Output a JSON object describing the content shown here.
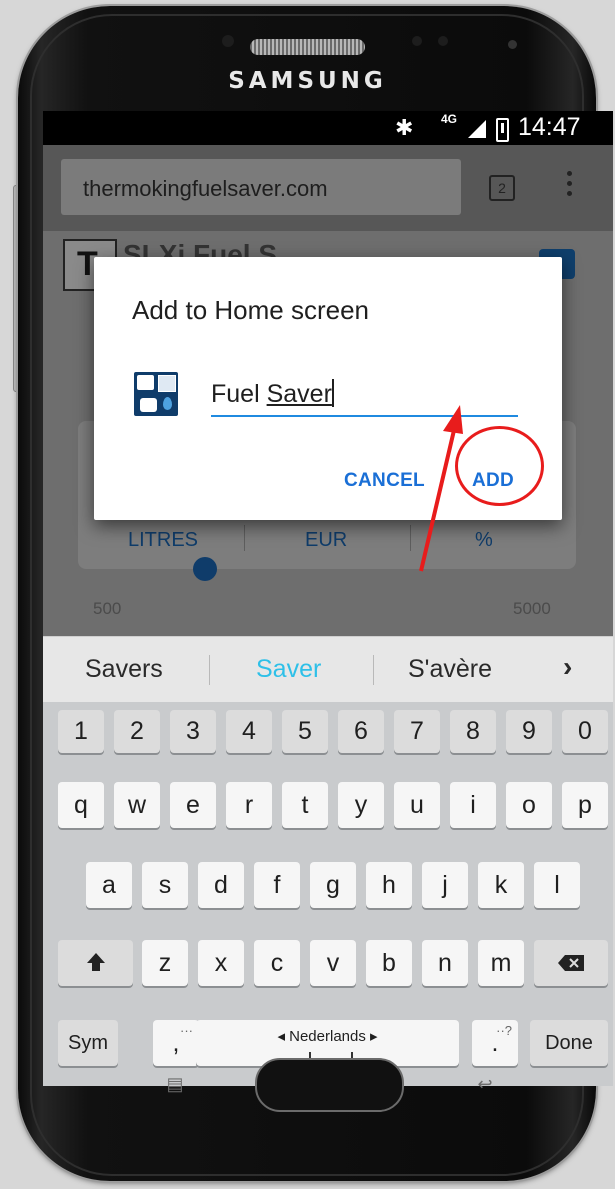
{
  "device": {
    "brand": "SAMSUNG"
  },
  "status_bar": {
    "bluetooth": "✱",
    "network": "4G",
    "time": "14:47"
  },
  "browser": {
    "url": "thermokingfuelsaver.com",
    "tab_count": "2"
  },
  "page": {
    "title": "SLXi Fuel S",
    "units": [
      "LITRES",
      "EUR",
      "%"
    ],
    "range_min": "500",
    "range_max": "5000"
  },
  "dialog": {
    "title": "Add to Home screen",
    "app_name_word1": "Fuel",
    "app_name_word2": "Saver",
    "cancel_label": "CANCEL",
    "add_label": "ADD"
  },
  "keyboard": {
    "suggestions": [
      "Savers",
      "Saver",
      "S'avère"
    ],
    "active_suggestion_color": "#2ec0e8",
    "number_row": [
      "1",
      "2",
      "3",
      "4",
      "5",
      "6",
      "7",
      "8",
      "9",
      "0"
    ],
    "row1": [
      "q",
      "w",
      "e",
      "r",
      "t",
      "y",
      "u",
      "i",
      "o",
      "p"
    ],
    "row2": [
      "a",
      "s",
      "d",
      "f",
      "g",
      "h",
      "j",
      "k",
      "l"
    ],
    "row3": [
      "z",
      "x",
      "c",
      "v",
      "b",
      "n",
      "m"
    ],
    "sym_label": "Sym",
    "comma_label": ",",
    "period_label": ".",
    "space_label": "◂ Nederlands ▸",
    "done_label": "Done"
  },
  "colors": {
    "accent": "#1f8ae0",
    "annotation": "#e81c1c"
  }
}
